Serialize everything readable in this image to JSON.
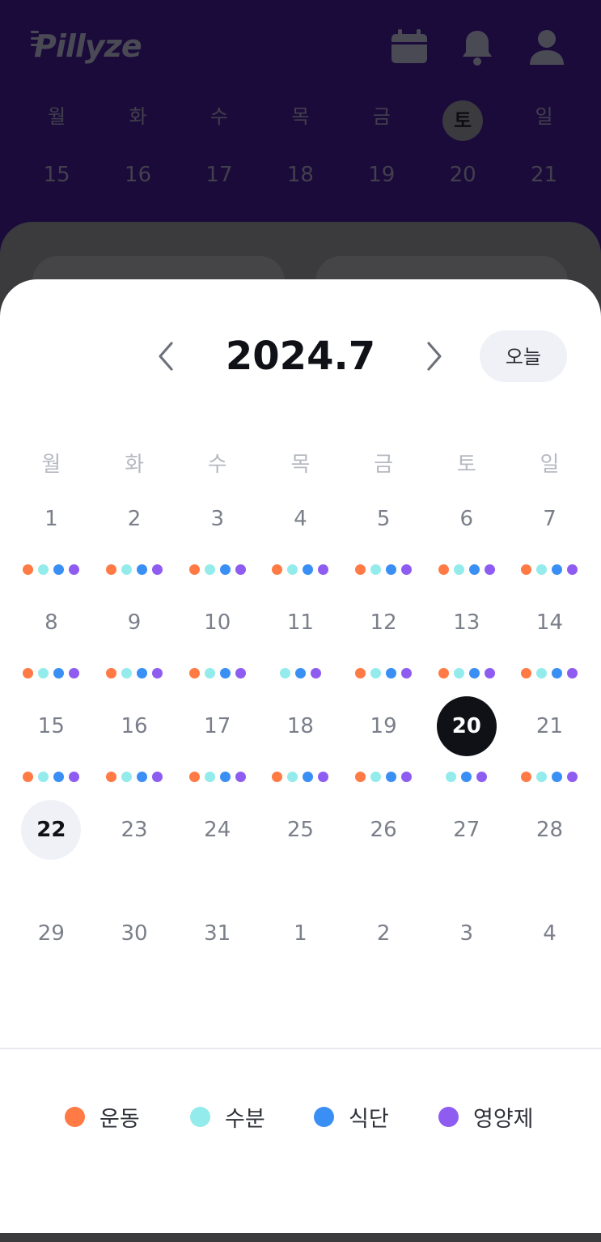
{
  "app": {
    "logo": "Pillyze"
  },
  "header": {
    "icons": [
      "calendar-icon",
      "bell-icon",
      "profile-icon"
    ]
  },
  "background_week": {
    "weekdays": [
      "월",
      "화",
      "수",
      "목",
      "금",
      "토",
      "일"
    ],
    "days": [
      "15",
      "16",
      "17",
      "18",
      "19",
      "20",
      "21"
    ],
    "selected_weekday": "토"
  },
  "calendar": {
    "title": "2024.7",
    "today_label": "오늘",
    "weekdays": [
      "월",
      "화",
      "수",
      "목",
      "금",
      "토",
      "일"
    ],
    "weeks": [
      [
        {
          "d": "1",
          "dots": [
            "exercise",
            "water",
            "diet",
            "supplement"
          ]
        },
        {
          "d": "2",
          "dots": [
            "exercise",
            "water",
            "diet",
            "supplement"
          ]
        },
        {
          "d": "3",
          "dots": [
            "exercise",
            "water",
            "diet",
            "supplement"
          ]
        },
        {
          "d": "4",
          "dots": [
            "exercise",
            "water",
            "diet",
            "supplement"
          ]
        },
        {
          "d": "5",
          "dots": [
            "exercise",
            "water",
            "diet",
            "supplement"
          ]
        },
        {
          "d": "6",
          "dots": [
            "exercise",
            "water",
            "diet",
            "supplement"
          ]
        },
        {
          "d": "7",
          "dots": [
            "exercise",
            "water",
            "diet",
            "supplement"
          ]
        }
      ],
      [
        {
          "d": "8",
          "dots": [
            "exercise",
            "water",
            "diet",
            "supplement"
          ]
        },
        {
          "d": "9",
          "dots": [
            "exercise",
            "water",
            "diet",
            "supplement"
          ]
        },
        {
          "d": "10",
          "dots": [
            "exercise",
            "water",
            "diet",
            "supplement"
          ]
        },
        {
          "d": "11",
          "dots": [
            "water",
            "diet",
            "supplement"
          ]
        },
        {
          "d": "12",
          "dots": [
            "exercise",
            "water",
            "diet",
            "supplement"
          ]
        },
        {
          "d": "13",
          "dots": [
            "exercise",
            "water",
            "diet",
            "supplement"
          ]
        },
        {
          "d": "14",
          "dots": [
            "exercise",
            "water",
            "diet",
            "supplement"
          ]
        }
      ],
      [
        {
          "d": "15",
          "dots": [
            "exercise",
            "water",
            "diet",
            "supplement"
          ]
        },
        {
          "d": "16",
          "dots": [
            "exercise",
            "water",
            "diet",
            "supplement"
          ]
        },
        {
          "d": "17",
          "dots": [
            "exercise",
            "water",
            "diet",
            "supplement"
          ]
        },
        {
          "d": "18",
          "dots": [
            "exercise",
            "water",
            "diet",
            "supplement"
          ]
        },
        {
          "d": "19",
          "dots": [
            "exercise",
            "water",
            "diet",
            "supplement"
          ]
        },
        {
          "d": "20",
          "dots": [
            "water",
            "diet",
            "supplement"
          ],
          "state": "selected"
        },
        {
          "d": "21",
          "dots": [
            "exercise",
            "water",
            "diet",
            "supplement"
          ]
        }
      ],
      [
        {
          "d": "22",
          "dots": [],
          "state": "today"
        },
        {
          "d": "23",
          "dots": []
        },
        {
          "d": "24",
          "dots": []
        },
        {
          "d": "25",
          "dots": []
        },
        {
          "d": "26",
          "dots": []
        },
        {
          "d": "27",
          "dots": []
        },
        {
          "d": "28",
          "dots": []
        }
      ],
      [
        {
          "d": "29",
          "dots": []
        },
        {
          "d": "30",
          "dots": []
        },
        {
          "d": "31",
          "dots": []
        },
        {
          "d": "1",
          "dots": []
        },
        {
          "d": "2",
          "dots": []
        },
        {
          "d": "3",
          "dots": []
        },
        {
          "d": "4",
          "dots": []
        }
      ]
    ]
  },
  "legend": {
    "items": [
      {
        "key": "exercise",
        "label": "운동",
        "color": "#ff7a45"
      },
      {
        "key": "water",
        "label": "수분",
        "color": "#93ebec"
      },
      {
        "key": "diet",
        "label": "식단",
        "color": "#3a8ff5"
      },
      {
        "key": "supplement",
        "label": "영양제",
        "color": "#8e5cf0"
      }
    ]
  },
  "colors": {
    "header_bg": "#1b0b3b",
    "selected_day_bg": "#0f1116",
    "today_day_bg": "#f0f1f6"
  }
}
